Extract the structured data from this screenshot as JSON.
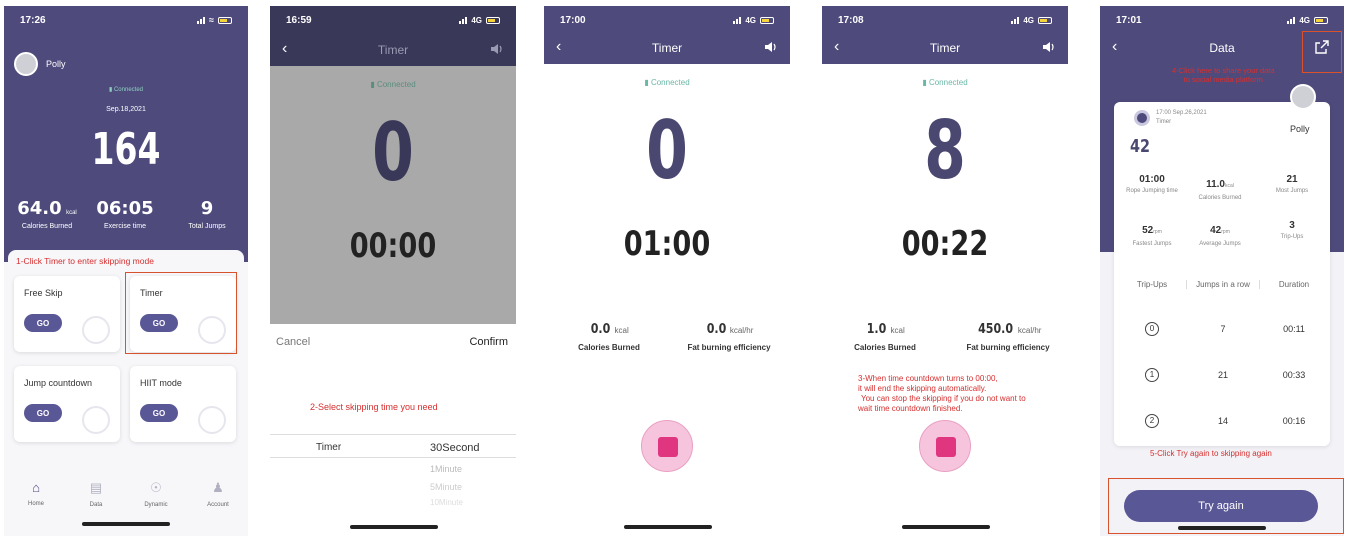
{
  "screen1": {
    "time": "17:26",
    "user": "Polly",
    "connected": "Connected",
    "date": "Sep.18,2021",
    "jumps": "164",
    "stats": [
      {
        "value": "64.0",
        "unit": "kcal",
        "label": "Calories Burned"
      },
      {
        "value": "06:05",
        "unit": "",
        "label": "Exercise time"
      },
      {
        "value": "9",
        "unit": "",
        "label": "Total Jumps"
      }
    ],
    "note": "1-Click Timer to enter skipping mode",
    "modes": [
      {
        "title": "Free Skip",
        "btn": "GO"
      },
      {
        "title": "Timer",
        "btn": "GO"
      },
      {
        "title": "Jump countdown",
        "btn": "GO"
      },
      {
        "title": "HIIT mode",
        "btn": "GO"
      }
    ],
    "tabs": [
      {
        "label": "Home",
        "icon": "home-icon"
      },
      {
        "label": "Data",
        "icon": "chart-icon"
      },
      {
        "label": "Dynamic",
        "icon": "medal-icon"
      },
      {
        "label": "Account",
        "icon": "person-icon"
      }
    ]
  },
  "screen2": {
    "time": "16:59",
    "network": "4G",
    "title": "Timer",
    "connected": "Connected",
    "count": "0",
    "clock": "00:00",
    "cancel": "Cancel",
    "confirm": "Confirm",
    "note": "2-Select skipping time you need",
    "picker_label": "Timer",
    "options": [
      "30Second",
      "1Minute",
      "5Minute",
      "10Minute"
    ]
  },
  "screen3": {
    "time": "17:00",
    "network": "4G",
    "title": "Timer",
    "connected": "Connected",
    "count": "0",
    "clock": "01:00",
    "calories": {
      "value": "0.0",
      "unit": "kcal",
      "label": "Calories Burned"
    },
    "fat": {
      "value": "0.0",
      "unit": "kcal/hr",
      "label": "Fat burning efficiency"
    }
  },
  "screen4": {
    "time": "17:08",
    "network": "4G",
    "title": "Timer",
    "connected": "Connected",
    "count": "8",
    "clock": "00:22",
    "calories": {
      "value": "1.0",
      "unit": "kcal",
      "label": "Calories Burned"
    },
    "fat": {
      "value": "450.0",
      "unit": "kcal/hr",
      "label": "Fat burning efficiency"
    },
    "note1": "3-When time countdown turns to 00:00,",
    "note2": "it will end the skipping automatically.",
    "note3": "You can stop the skipping if you do not want to",
    "note4": "wait time countdown finished."
  },
  "screen5": {
    "time": "17:01",
    "network": "4G",
    "title": "Data",
    "share_note1": "4-Click here to share your data",
    "share_note2": "to social media platform",
    "session_time": "17:00 Sep.26,2021",
    "mode": "Timer",
    "jumps": "42",
    "user": "Polly",
    "grid": [
      {
        "value": "01:00",
        "unit": "",
        "label": "Rope Jumping time"
      },
      {
        "value": "11.0",
        "unit": "kcal",
        "label": "Calories Burned"
      },
      {
        "value": "21",
        "unit": "",
        "label": "Most Jumps"
      },
      {
        "value": "52",
        "unit": "rpm",
        "label": "Fastest Jumps"
      },
      {
        "value": "42",
        "unit": "rpm",
        "label": "Average Jumps"
      },
      {
        "value": "3",
        "unit": "",
        "label": "Trip-Ups"
      }
    ],
    "table_headers": [
      "Trip-Ups",
      "Jumps in a row",
      "Duration"
    ],
    "table_rows": [
      {
        "trip": "0",
        "jumps": "7",
        "duration": "00:11"
      },
      {
        "trip": "1",
        "jumps": "21",
        "duration": "00:33"
      },
      {
        "trip": "2",
        "jumps": "14",
        "duration": "00:16"
      }
    ],
    "note": "5-Click Try again to skipping again",
    "try_again": "Try again"
  }
}
